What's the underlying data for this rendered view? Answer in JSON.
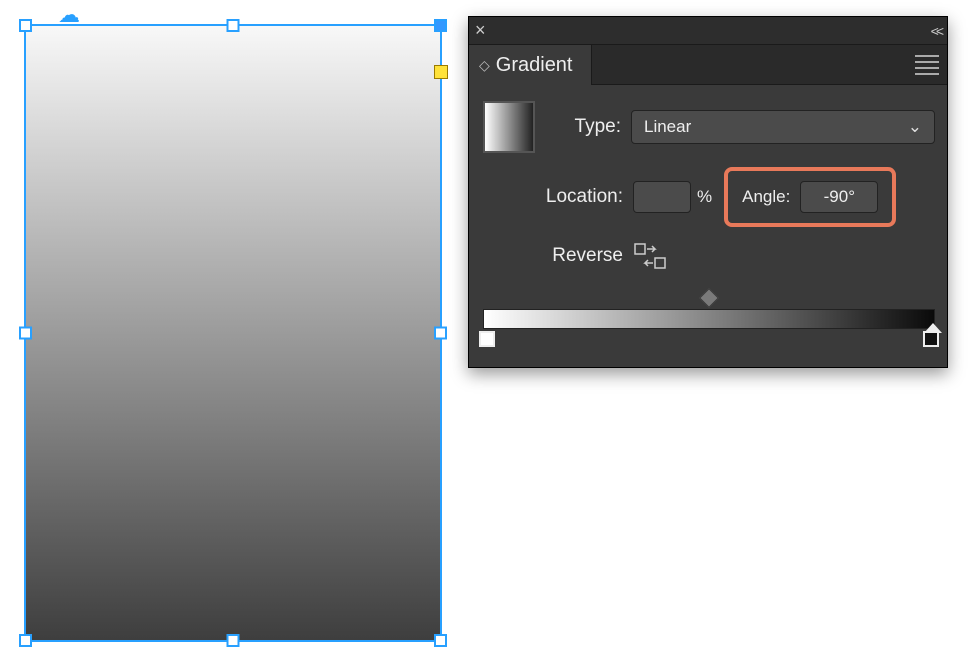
{
  "panel": {
    "title": "Gradient",
    "type_label": "Type:",
    "type_value": "Linear",
    "location_label": "Location:",
    "location_value": "",
    "location_unit": "%",
    "angle_label": "Angle:",
    "angle_value": "-90°",
    "reverse_label": "Reverse"
  },
  "colors": {
    "highlight": "#e8795a",
    "selection": "#28a0ff"
  }
}
